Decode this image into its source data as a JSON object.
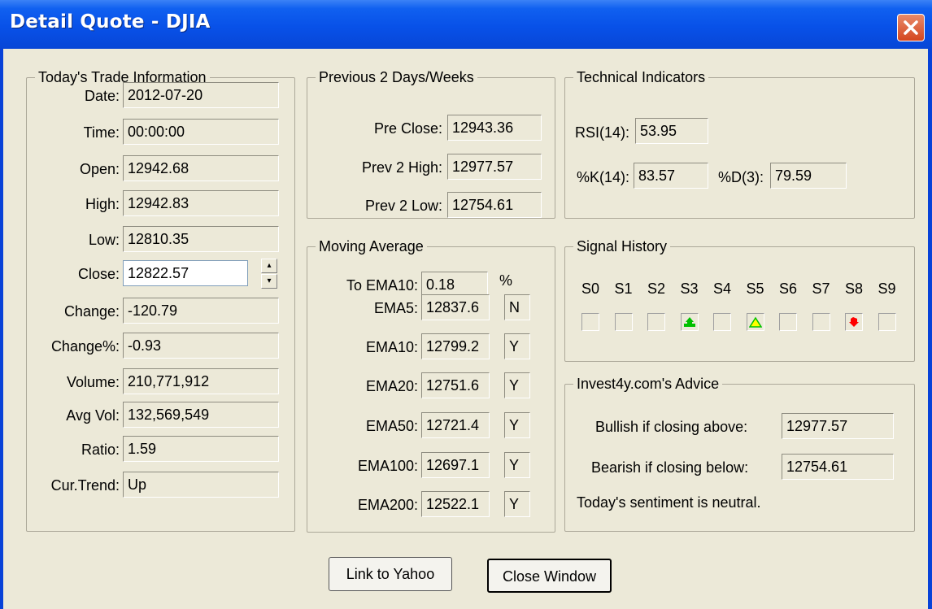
{
  "window": {
    "title": "Detail Quote - DJIA"
  },
  "trade": {
    "title": "Today's Trade Information",
    "rows": [
      {
        "label": "Date:",
        "value": "2012-07-20"
      },
      {
        "label": "Time:",
        "value": "00:00:00"
      },
      {
        "label": "Open:",
        "value": "12942.68"
      },
      {
        "label": "High:",
        "value": "12942.83"
      },
      {
        "label": "Low:",
        "value": "12810.35"
      },
      {
        "label": "Close:",
        "value": "12822.57"
      },
      {
        "label": "Change:",
        "value": "-120.79"
      },
      {
        "label": "Change%:",
        "value": "-0.93"
      },
      {
        "label": "Volume:",
        "value": "210,771,912"
      },
      {
        "label": "Avg Vol:",
        "value": "132,569,549"
      },
      {
        "label": "Ratio:",
        "value": "1.59"
      },
      {
        "label": "Cur.Trend:",
        "value": "Up"
      }
    ]
  },
  "previous": {
    "title": "Previous 2 Days/Weeks",
    "rows": [
      {
        "label": "Pre Close:",
        "value": "12943.36"
      },
      {
        "label": "Prev 2 High:",
        "value": "12977.57"
      },
      {
        "label": "Prev 2 Low:",
        "value": "12754.61"
      }
    ]
  },
  "moving": {
    "title": "Moving Average",
    "to_ema_label": "To EMA10:",
    "to_ema_value": "0.18",
    "percent": "%",
    "rows": [
      {
        "label": "EMA5:",
        "value": "12837.6",
        "flag": "N"
      },
      {
        "label": "EMA10:",
        "value": "12799.2",
        "flag": "Y"
      },
      {
        "label": "EMA20:",
        "value": "12751.6",
        "flag": "Y"
      },
      {
        "label": "EMA50:",
        "value": "12721.4",
        "flag": "Y"
      },
      {
        "label": "EMA100:",
        "value": "12697.1",
        "flag": "Y"
      },
      {
        "label": "EMA200:",
        "value": "12522.1",
        "flag": "Y"
      }
    ]
  },
  "technical": {
    "title": "Technical Indicators",
    "rsi_label": "RSI(14):",
    "rsi_value": "53.95",
    "k_label": "%K(14):",
    "k_value": "83.57",
    "d_label": "%D(3):",
    "d_value": "79.59"
  },
  "signal": {
    "title": "Signal History",
    "labels": [
      "S0",
      "S1",
      "S2",
      "S3",
      "S4",
      "S5",
      "S6",
      "S7",
      "S8",
      "S9"
    ],
    "icons": [
      "",
      "",
      "",
      "green-up-arrow-icon",
      "",
      "yellow-triangle-icon",
      "",
      "",
      "red-down-arrow-icon",
      ""
    ],
    "colors": {
      "green": "#00c000",
      "yellow": "#ffff00",
      "red": "#ff0000"
    }
  },
  "advice": {
    "title": "Invest4y.com's Advice",
    "bullish_label": "Bullish if closing above:",
    "bullish_value": "12977.57",
    "bearish_label": "Bearish if closing below:",
    "bearish_value": "12754.61",
    "sentiment": "Today's sentiment is neutral."
  },
  "buttons": {
    "yahoo": "Link to Yahoo",
    "close": "Close Window"
  }
}
